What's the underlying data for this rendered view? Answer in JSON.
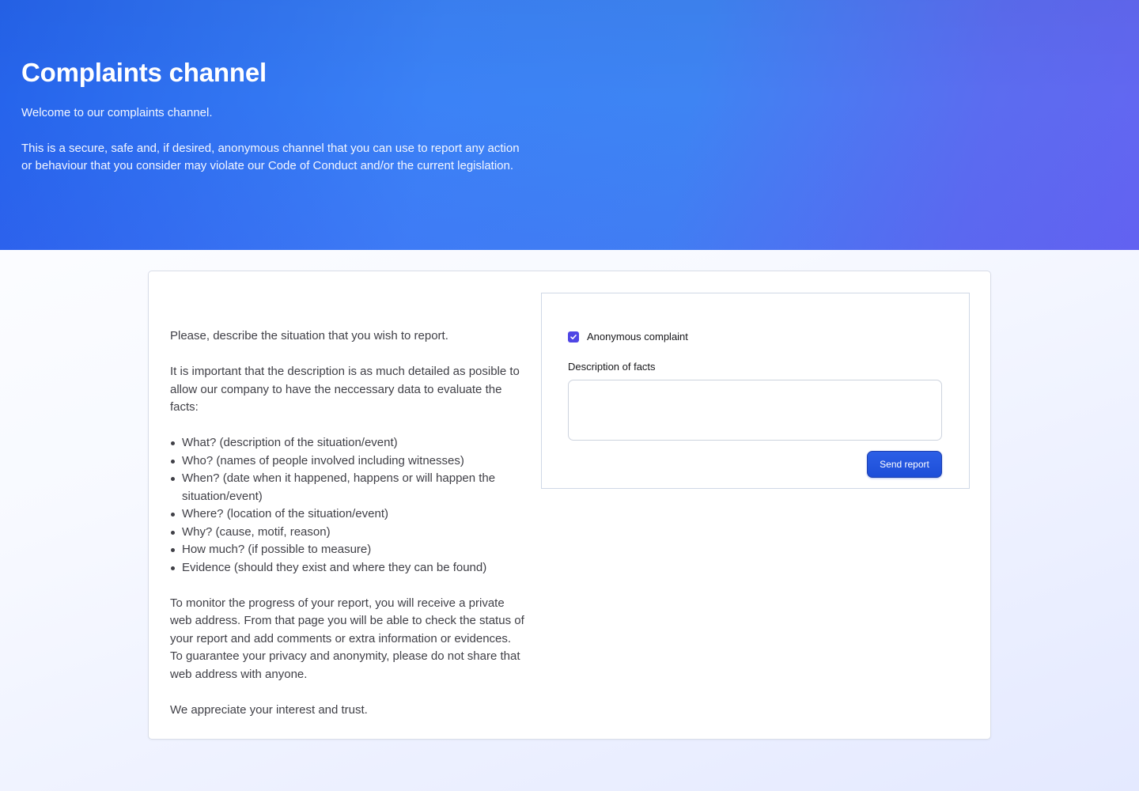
{
  "hero": {
    "title": "Complaints channel",
    "welcome": "Welcome to our complaints channel.",
    "intro": "This is a secure, safe and, if desired, anonymous channel that you can use to report any action or behaviour that you consider may violate our Code of Conduct and/or the current legislation."
  },
  "instructions": {
    "p1": "Please, describe the situation that you wish to report.",
    "p2": "It is important that the description is as much detailed as posible to allow our company to have the neccessary data to evaluate the facts:",
    "items": [
      "What? (description of the situation/event)",
      "Who? (names of people involved including witnesses)",
      "When? (date when it happened, happens or will happen the situation/event)",
      "Where? (location of the situation/event)",
      "Why? (cause, motif, reason)",
      "How much? (if possible to measure)",
      "Evidence (should they exist and where they can be found)"
    ],
    "p3": "To monitor the progress of your report, you will receive a private web address. From that page you will be able to check the status of your report and add comments or extra information or evidences. To guarantee your privacy and anonymity, please do not share that web address with anyone.",
    "p4": "We appreciate your interest and trust."
  },
  "form": {
    "anonymous_label": "Anonymous complaint",
    "anonymous_checked": true,
    "description_label": "Description of facts",
    "description_value": "",
    "send_label": "Send report"
  },
  "colors": {
    "hero_start": "#2563eb",
    "hero_end": "#6366f1",
    "checkbox": "#4f46e5",
    "button": "#1d4ed8"
  },
  "icons": {
    "checkbox_mark": "check-icon"
  }
}
